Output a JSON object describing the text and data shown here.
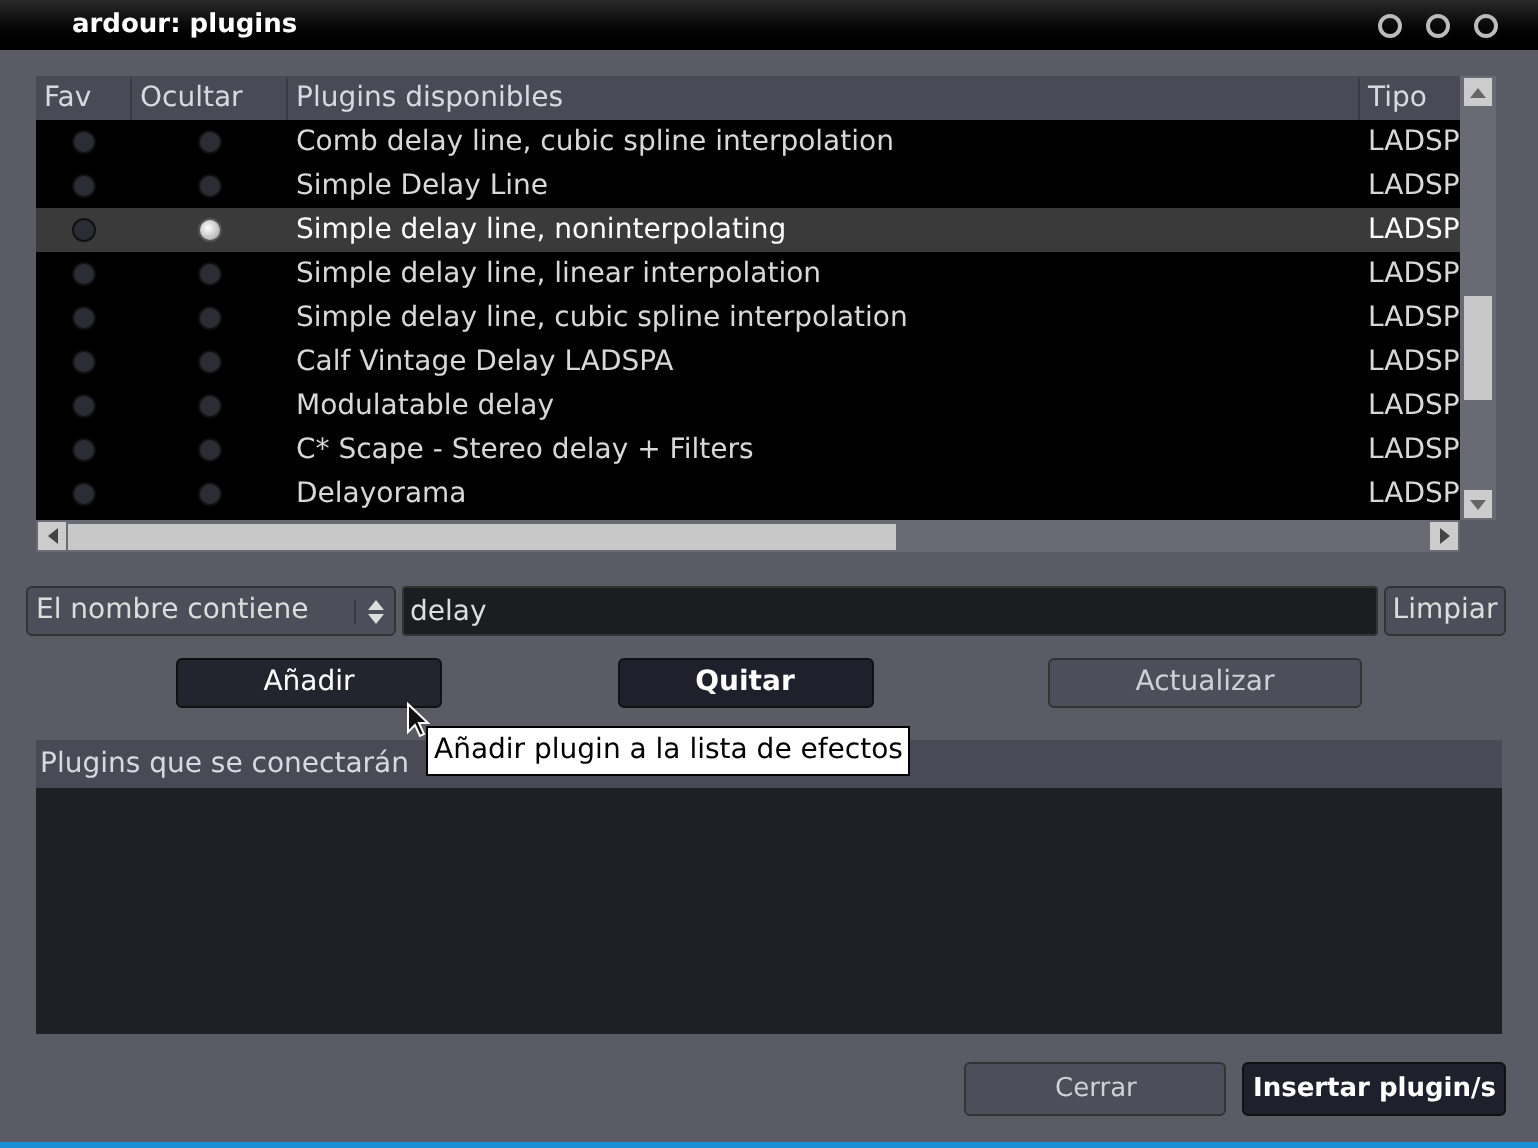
{
  "window": {
    "title": "ardour: plugins"
  },
  "table": {
    "columns": [
      "Fav",
      "Ocultar",
      "Plugins disponibles",
      "Tipo"
    ],
    "rows": [
      {
        "name": "Comb delay line, cubic spline interpolation",
        "type": "LADSP",
        "fav": false,
        "hidden": false,
        "selected": false
      },
      {
        "name": "Simple Delay Line",
        "type": "LADSP",
        "fav": false,
        "hidden": false,
        "selected": false
      },
      {
        "name": "Simple delay line, noninterpolating",
        "type": "LADSP",
        "fav": false,
        "hidden": true,
        "selected": true
      },
      {
        "name": "Simple delay line, linear interpolation",
        "type": "LADSP",
        "fav": false,
        "hidden": false,
        "selected": false
      },
      {
        "name": "Simple delay line, cubic spline interpolation",
        "type": "LADSP",
        "fav": false,
        "hidden": false,
        "selected": false
      },
      {
        "name": "Calf Vintage Delay LADSPA",
        "type": "LADSP",
        "fav": false,
        "hidden": false,
        "selected": false
      },
      {
        "name": "Modulatable delay",
        "type": "LADSP",
        "fav": false,
        "hidden": false,
        "selected": false
      },
      {
        "name": "C* Scape - Stereo delay + Filters",
        "type": "LADSP",
        "fav": false,
        "hidden": false,
        "selected": false
      },
      {
        "name": "Delayorama",
        "type": "LADSP",
        "fav": false,
        "hidden": false,
        "selected": false
      }
    ]
  },
  "filter": {
    "mode": "El nombre contiene",
    "value": "delay",
    "clear_button": "Limpiar"
  },
  "actions": [
    {
      "label": "Añadir",
      "kind": "normal"
    },
    {
      "label": "Quitar",
      "kind": "bold"
    },
    {
      "label": "Actualizar",
      "kind": "flat"
    }
  ],
  "tooltip": "Añadir plugin a la lista de efectos",
  "selected_panel": {
    "title": "Plugins que se conectarán"
  },
  "footer": [
    {
      "label": "Cerrar",
      "kind": "flat"
    },
    {
      "label": "Insertar plugin/s",
      "kind": "bold"
    }
  ]
}
